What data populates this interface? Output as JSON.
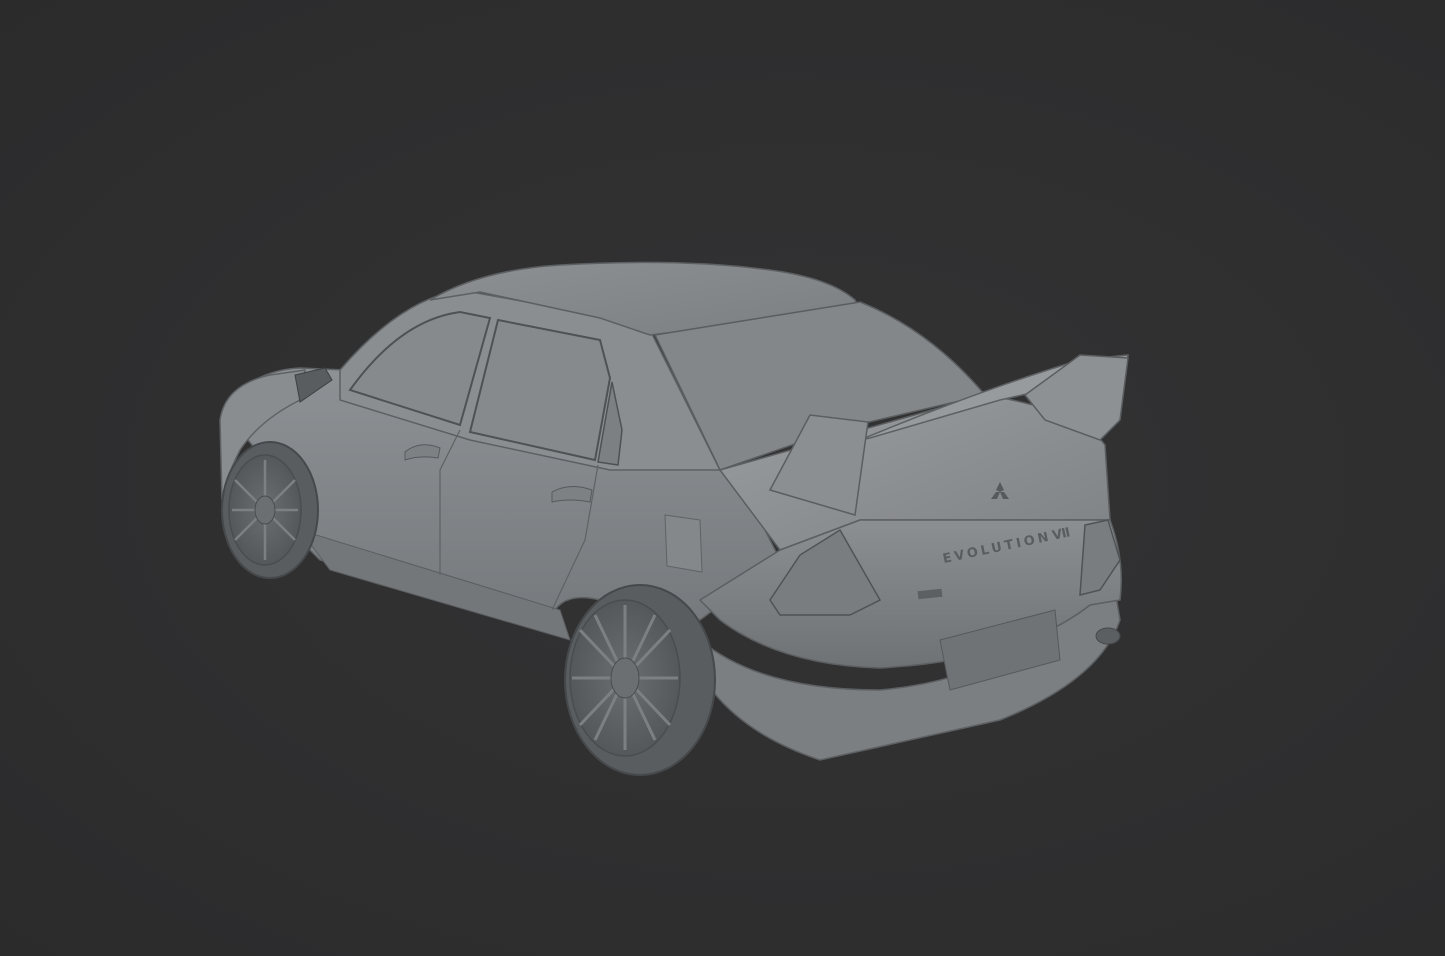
{
  "viewport": {
    "background": "#2e2e2f",
    "model_color": "#8e9193"
  },
  "model": {
    "badge_text": "EVOLUTION",
    "badge_numeral": "Ⅶ"
  }
}
